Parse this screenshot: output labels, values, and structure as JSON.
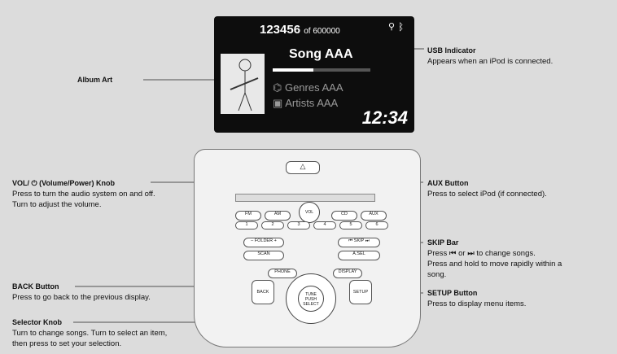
{
  "screen": {
    "track_number": "123456",
    "track_total": "of 600000",
    "song": "Song AAA",
    "genre": "Genres AAA",
    "artist": "Artists AAA",
    "clock": "12:34",
    "progress_fraction": 0.42
  },
  "console": {
    "fm": "FM",
    "am": "AM",
    "cd": "CD",
    "aux": "AUX",
    "vol": "VOL",
    "presets": [
      "1",
      "2",
      "3",
      "4",
      "5",
      "6"
    ],
    "folder": "– FOLDER +",
    "scan": "SCAN",
    "skip": "SKIP",
    "asel": "A.SEL",
    "phone": "PHONE",
    "display": "DISPLAY",
    "back": "BACK",
    "setup": "SETUP",
    "tune": "TUNE",
    "push": "PUSH",
    "select": "SELECT"
  },
  "annotations": {
    "usb": {
      "title": "USB Indicator",
      "desc": "Appears when an iPod is connected."
    },
    "album": {
      "title": "Album Art"
    },
    "vol": {
      "title": "VOL/ ⏻ (Volume/Power) Knob",
      "desc1": "Press to turn the audio system on and off.",
      "desc2": "Turn to adjust the volume."
    },
    "aux": {
      "title": "AUX Button",
      "desc": "Press to select iPod (if connected)."
    },
    "skip": {
      "title": "SKIP Bar",
      "desc1": "Press ⏮ or ⏭ to change songs.",
      "desc2": "Press and hold to move rapidly within a",
      "desc3": "song."
    },
    "back": {
      "title": "BACK Button",
      "desc": "Press to go back to the previous display."
    },
    "setup": {
      "title": "SETUP Button",
      "desc": "Press to display menu items."
    },
    "selector": {
      "title": "Selector Knob",
      "desc1": "Turn to change songs. Turn to select an item,",
      "desc2": "then press to set your selection."
    }
  }
}
